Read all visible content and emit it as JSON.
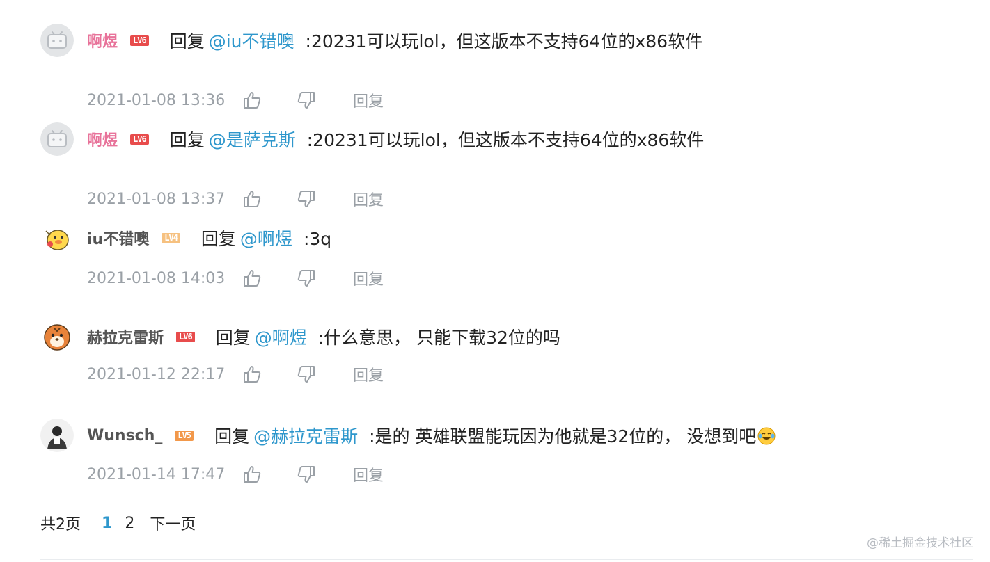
{
  "colors": {
    "accent": "#2e97cc",
    "vip_name": "#e8739a",
    "normal_name": "#555555",
    "meta": "#9aa0a6",
    "lv6": "#e84c4c",
    "lv5": "#f2984a",
    "lv4": "#f6c180"
  },
  "comments": [
    {
      "user": "啊煜",
      "level": "LV6",
      "avatar_icon": "bilibili-tv-icon",
      "reply_word": "回复",
      "mention": "@iu不错噢",
      "text": ":20231可以玩lol，但这版本不支持64位的x86软件",
      "time": "2021-01-08 13:36",
      "reply_label": "回复"
    },
    {
      "user": "啊煜",
      "level": "LV6",
      "avatar_icon": "bilibili-tv-icon",
      "reply_word": "回复",
      "mention": "@是萨克斯",
      "text": ":20231可以玩lol，但这版本不支持64位的x86软件",
      "time": "2021-01-08 13:37",
      "reply_label": "回复"
    },
    {
      "user": "iu不错噢",
      "level": "LV4",
      "avatar_icon": "yellow-duck-icon",
      "reply_word": "回复",
      "mention": "@啊煜",
      "text": ":3q",
      "time": "2021-01-08 14:03",
      "reply_label": "回复"
    },
    {
      "user": "赫拉克雷斯",
      "level": "LV6",
      "avatar_icon": "tiger-icon",
      "reply_word": "回复",
      "mention": "@啊煜",
      "text": ":什么意思， 只能下载32位的吗",
      "time": "2021-01-12 22:17",
      "reply_label": "回复"
    },
    {
      "user": "Wunsch_",
      "level": "LV5",
      "avatar_icon": "person-photo-icon",
      "reply_word": "回复",
      "mention": "@赫拉克雷斯",
      "text": ":是的  英雄联盟能玩因为他就是32位的， 没想到吧",
      "emoji": "laughing-crying-emoji",
      "time": "2021-01-14 17:47",
      "reply_label": "回复"
    }
  ],
  "pagination": {
    "total": "共2页",
    "pages": [
      "1",
      "2"
    ],
    "current": "1",
    "next": "下一页"
  },
  "watermark": "@稀土掘金技术社区"
}
